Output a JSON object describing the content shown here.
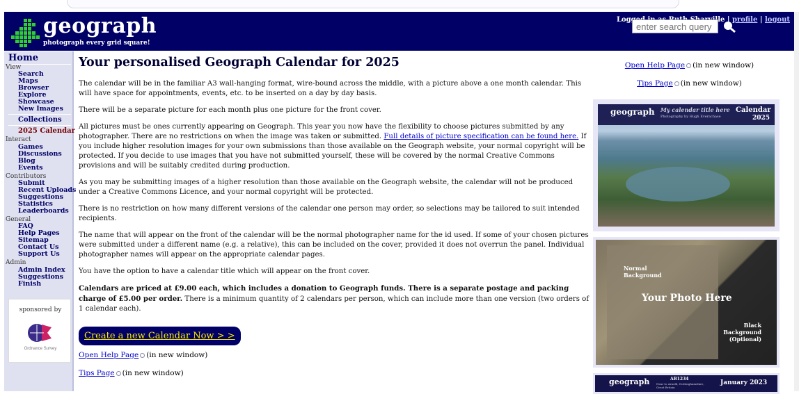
{
  "header": {
    "logo_word": "geograph",
    "logo_tagline": "photograph every grid square!",
    "login_prefix": "Logged in as Ruth Sharville |",
    "profile_link": "profile",
    "logout_link": "logout",
    "search_placeholder": "enter search query"
  },
  "sidebar": {
    "home": "Home",
    "sections": [
      {
        "heading": "View",
        "links": [
          "Search",
          "Maps",
          "Browser",
          "Explore",
          "Showcase",
          "New Images"
        ]
      },
      {
        "heading": "",
        "links": [
          "Collections",
          "2025 Calendar"
        ]
      },
      {
        "heading": "Interact",
        "links": [
          "Games",
          "Discussions",
          "Blog",
          "Events"
        ]
      },
      {
        "heading": "Contributors",
        "links": [
          "Submit",
          "Recent Uploads",
          "Suggestions",
          "Statistics",
          "Leaderboards"
        ]
      },
      {
        "heading": "General",
        "links": [
          "FAQ",
          "Help Pages",
          "Sitemap",
          "Contact Us",
          "Support Us"
        ]
      },
      {
        "heading": "Admin",
        "links": [
          "Admin Index",
          "Suggestions",
          "Finish"
        ]
      }
    ],
    "sponsored_by": "sponsored by",
    "sponsor_name": "Ordnance Survey"
  },
  "main": {
    "title": "Your personalised Geograph Calendar for 2025",
    "p1": "The calendar will be in the familiar A3 wall-hanging format, wire-bound across the middle, with a picture above a one month calendar. This will have space for appointments, events, etc. to be inserted on a day by day basis.",
    "p2": "There will be a separate picture for each month plus one picture for the front cover.",
    "p3_a": "All pictures must be ones currently appearing on Geograph. This year you now have the flexibility to choose pictures submitted by any photographer. There are no restrictions on when the image was taken or submitted. ",
    "p3_link": "Full details of picture specification can be found here.",
    "p3_b": " If you include higher resolution images for your own submissions than those available on the Geograph website, your normal copyright will be protected. If you decide to use images that you have not submitted yourself, these will be covered by the normal Creative Commons provisions and will be suitably credited during production.",
    "p4": "As you may be submitting images of a higher resolution than those available on the Geograph website, the calendar will not be produced under a Creative Commons Licence, and your normal copyright will be protected.",
    "p5": "There is no restriction on how many different versions of the calendar one person may order, so selections may be tailored to suit intended recipients.",
    "p6": "The name that will appear on the front of the calendar will be the normal photographer name for the id used. If some of your chosen pictures were submitted under a different name (e.g. a relative), this can be included on the cover, provided it does not overrun the panel. Individual photographer names will appear on the appropriate calendar pages.",
    "p7": "You have the option to have a calendar title which will appear on the front cover.",
    "p8_bold": "Calendars are priced at £9.00 each, which includes a donation to Geograph funds. There is a separate postage and packing charge of £5.00 per order.",
    "p8_rest": " There is a minimum quantity of 2 calendars per person, which can include more than one version (two orders of 1 calendar each).",
    "cta": "Create a new Calendar Now > >",
    "help_link": "Open Help Page",
    "tips_link": "Tips Page",
    "new_window": "(in new window)"
  },
  "right_panel": {
    "help_link": "Open Help Page",
    "tips_link": "Tips Page",
    "new_window": "(in new window)",
    "cover": {
      "logo": "geograph",
      "title_here": "My calendar title here",
      "credit": "Photography by Hugh Everachase",
      "calendar": "Calendar",
      "year": "2025"
    },
    "sample": {
      "normal": "Normal Background",
      "your_photo": "Your Photo Here",
      "black": "Black Background (Optional)"
    },
    "month_strip": {
      "logo": "geograph",
      "gridref": "AB1234",
      "place": "Near to Arnold, Nottinghamshire, Great Britain",
      "month": "January 2023"
    }
  },
  "colors": {
    "navy": "#000066",
    "sidebar_bg": "#dfe0f0",
    "link": "#0000cc",
    "cta_text": "#ffee00"
  }
}
